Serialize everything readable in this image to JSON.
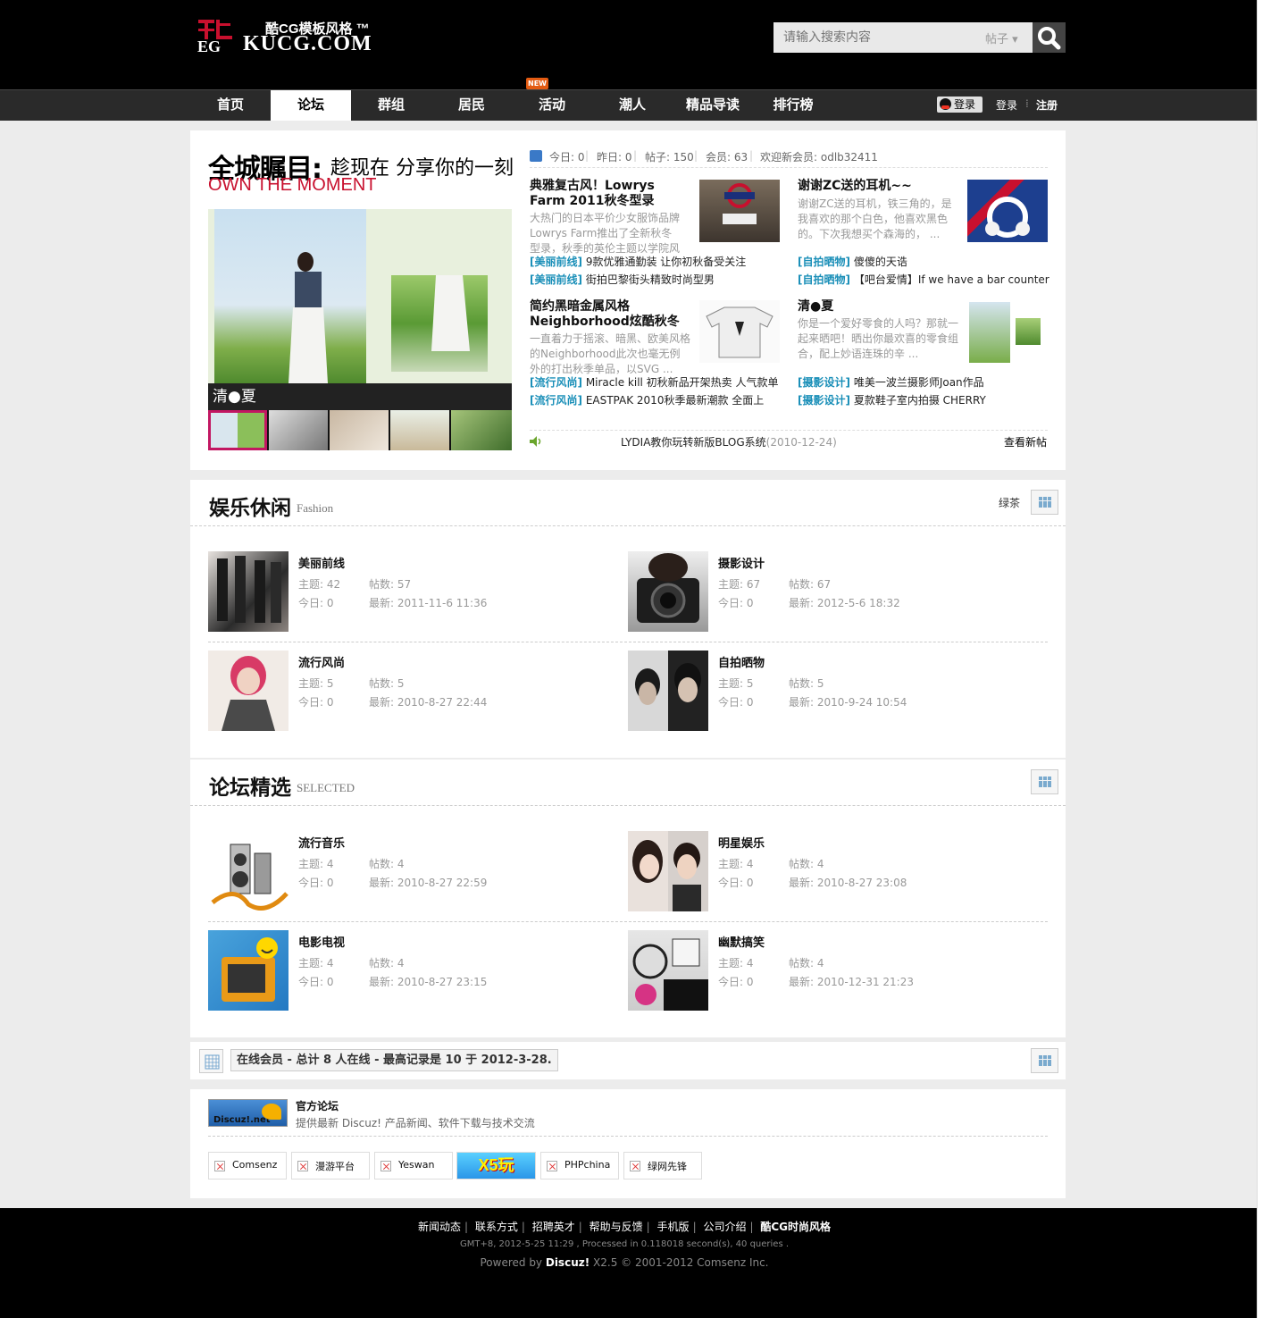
{
  "header": {
    "logo_top": "酷CG模板风格 ™",
    "logo_bottom": "KUCG.COM",
    "search_placeholder": "请输入搜索内容",
    "search_type": "帖子 ▾"
  },
  "nav": {
    "items": [
      "首页",
      "论坛",
      "群组",
      "居民",
      "活动",
      "潮人",
      "精品导读",
      "排行榜"
    ],
    "active": "论坛",
    "new_badge": "NEW",
    "qq_login": "登录",
    "login": "登录",
    "register": "注册"
  },
  "hero": {
    "title": "全城瞩目:",
    "title_sub": "趁现在 分享你的一刻",
    "title_en": "OWN THE MOMENT",
    "caption": "清●夏",
    "stats": {
      "today": "今日: 0",
      "yesterday": "昨日: 0",
      "posts": "帖子: 150",
      "members": "会员: 63",
      "newest": "欢迎新会员: odlb32411"
    },
    "posts": [
      {
        "title": "典雅复古风！Lowrys Farm 2011秋冬型录",
        "body": "大热门的日本平价少女服饰品牌Lowrys Farm推出了全新秋冬型录，秋季的英伦主题以学院风 ..."
      },
      {
        "title": "谢谢ZC送的耳机~~",
        "body": "谢谢ZC送的耳机，铁三角的，是我喜欢的那个白色，他喜欢黑色的。下次我想买个森海的， ..."
      },
      {
        "title": "简约黑暗金属风格 Neighborhood炫酷秋冬",
        "body": "一直着力于摇滚、暗黑、欧美风格的Neighborhood此次也毫无例外的打出秋季单品，以SVG ..."
      },
      {
        "title": "清●夏",
        "body": "你是一个爱好零食的人吗？那就一起来晒吧！晒出你最欢喜的零食组合，配上妙语连珠的辛 ..."
      }
    ],
    "cat_lines": [
      {
        "tag": "[美丽前线]",
        "text": "9款优雅通勤装 让你初秋备受关注"
      },
      {
        "tag": "[美丽前线]",
        "text": "街拍巴黎街头精致时尚型男"
      },
      {
        "tag": "[自拍晒物]",
        "text": "傻傻的天诰"
      },
      {
        "tag": "[自拍晒物]",
        "text": "【吧台爱情】If we have a bar counter"
      },
      {
        "tag": "[流行风尚]",
        "text": "Miracle kill 初秋新品开架热卖  人气款单"
      },
      {
        "tag": "[流行风尚]",
        "text": "EASTPAK 2010秋季最新潮款  全面上"
      },
      {
        "tag": "[摄影设计]",
        "text": "唯美一波兰摄影师Joan作品"
      },
      {
        "tag": "[摄影设计]",
        "text": "夏款鞋子室内拍摄  CHERRY"
      }
    ],
    "news": "LYDIA教你玩转新版BLOG系统",
    "news_date": "(2010-12-24)",
    "news_more": "查看新帖"
  },
  "section1": {
    "title": "娱乐休闲",
    "sub": "Fashion",
    "moderator": "绿茶",
    "forums": [
      {
        "name": "美丽前线",
        "topics": "主题: 42",
        "posts": "帖数: 57",
        "today": "今日: 0",
        "latest": "最新: 2011-11-6 11:36"
      },
      {
        "name": "摄影设计",
        "topics": "主题: 67",
        "posts": "帖数: 67",
        "today": "今日: 0",
        "latest": "最新: 2012-5-6 18:32"
      },
      {
        "name": "流行风尚",
        "topics": "主题: 5",
        "posts": "帖数: 5",
        "today": "今日: 0",
        "latest": "最新: 2010-8-27 22:44"
      },
      {
        "name": "自拍晒物",
        "topics": "主题: 5",
        "posts": "帖数: 5",
        "today": "今日: 0",
        "latest": "最新: 2010-9-24 10:54"
      }
    ]
  },
  "section2": {
    "title": "论坛精选",
    "sub": "SELECTED",
    "forums": [
      {
        "name": "流行音乐",
        "topics": "主题: 4",
        "posts": "帖数: 4",
        "today": "今日: 0",
        "latest": "最新: 2010-8-27 22:59"
      },
      {
        "name": "明星娱乐",
        "topics": "主题: 4",
        "posts": "帖数: 4",
        "today": "今日: 0",
        "latest": "最新: 2010-8-27 23:08"
      },
      {
        "name": "电影电视",
        "topics": "主题: 4",
        "posts": "帖数: 4",
        "today": "今日: 0",
        "latest": "最新: 2010-8-27 23:15"
      },
      {
        "name": "幽默搞笑",
        "topics": "主题: 4",
        "posts": "帖数: 4",
        "today": "今日: 0",
        "latest": "最新: 2010-12-31 21:23"
      }
    ]
  },
  "online": {
    "text": "在线会员 - 总计 8 人在线 - 最高记录是 10 于 2012-3-28."
  },
  "links": {
    "discuz_label": "Discuz!.net",
    "official_title": "官方论坛",
    "official_desc": "提供最新 Discuz! 产品新闻、软件下载与技术交流",
    "friends": [
      "Comsenz",
      "漫游平台",
      "Yeswan",
      "X5玩",
      "PHPchina",
      "绿网先锋"
    ]
  },
  "footer": {
    "links": [
      "新闻动态",
      "联系方式",
      "招聘英才",
      "帮助与反馈",
      "手机版",
      "公司介绍",
      "酷CG时尚风格"
    ],
    "info": "GMT+8, 2012-5-25 11:29 , Processed in 0.118018 second(s), 40 queries .",
    "powered_prefix": "Powered by ",
    "powered_brand": "Discuz!",
    "powered_suffix": " X2.5 © 2001-2012 Comsenz Inc."
  }
}
